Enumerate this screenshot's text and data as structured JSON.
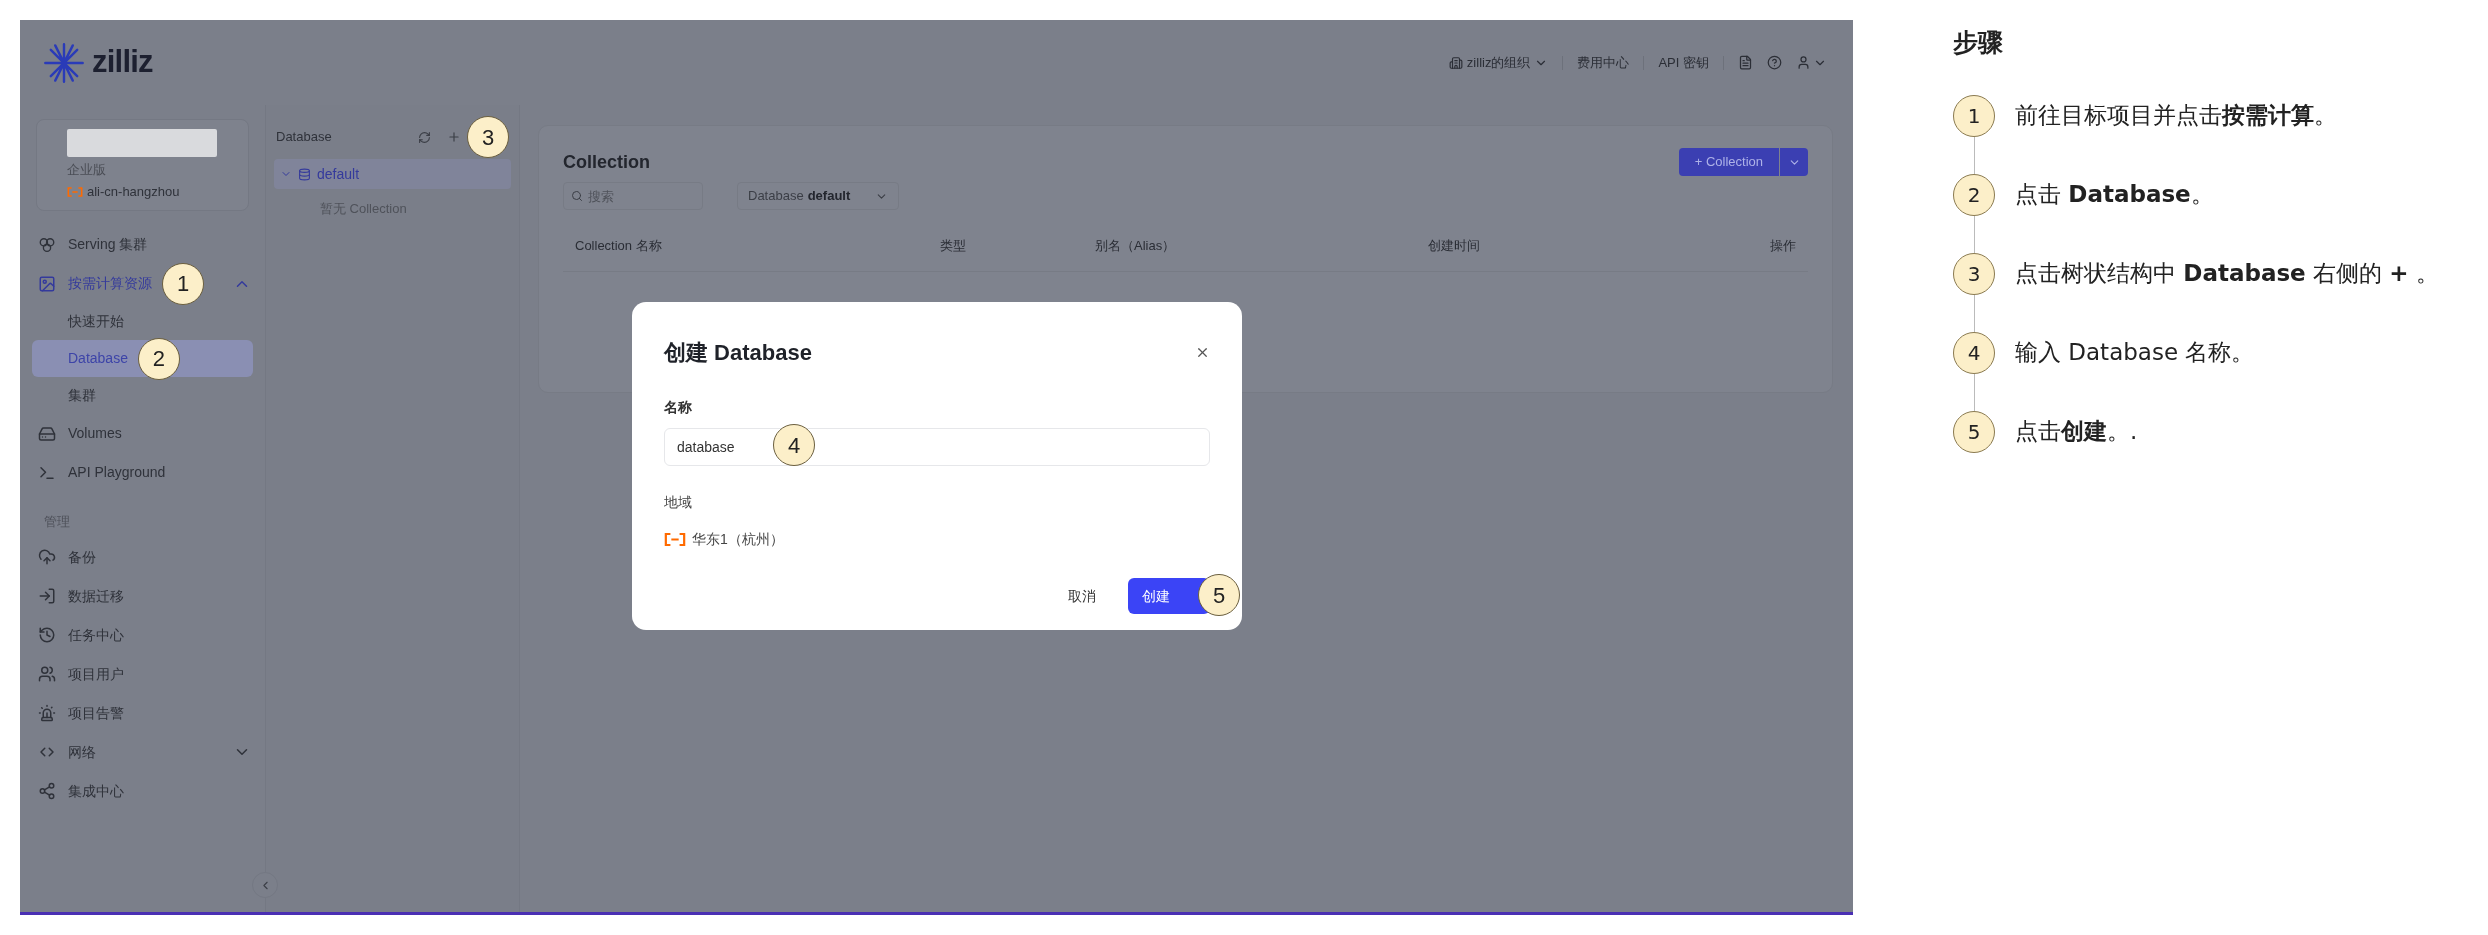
{
  "header": {
    "logo_text": "zilliz",
    "org": "zilliz的组织",
    "links": [
      "费用中心",
      "API 密钥"
    ]
  },
  "project": {
    "edition": "企业版",
    "region": "ali-cn-hangzhou"
  },
  "sidebar": {
    "items": [
      {
        "label": "Serving 集群",
        "selected": false
      },
      {
        "label": "按需计算资源",
        "selected": true,
        "expanded": true,
        "marker": "1",
        "children": [
          {
            "label": "快速开始",
            "selected": false
          },
          {
            "label": "Database",
            "selected": true,
            "marker": "2"
          },
          {
            "label": "集群",
            "selected": false
          }
        ]
      },
      {
        "label": "Volumes",
        "selected": false
      },
      {
        "label": "API Playground",
        "selected": false
      }
    ],
    "section": "管理",
    "manage_items": [
      {
        "label": "备份",
        "selected": false
      },
      {
        "label": "数据迁移",
        "selected": false
      },
      {
        "label": "任务中心",
        "selected": false
      },
      {
        "label": "项目用户",
        "selected": false
      },
      {
        "label": "项目告警",
        "selected": false
      },
      {
        "label": "网络",
        "selected": false,
        "expanded": false
      },
      {
        "label": "集成中心",
        "selected": false
      }
    ]
  },
  "tree": {
    "title": "Database",
    "marker": "3",
    "nodes": [
      {
        "label": "default",
        "expanded": true,
        "selected": true,
        "empty_text": "暂无 Collection"
      }
    ]
  },
  "main": {
    "title": "Collection",
    "search_placeholder": "搜索",
    "database_select": {
      "label": "Database",
      "value": "default"
    },
    "new_button": "+ Collection",
    "columns": [
      "Collection 名称",
      "类型",
      "别名（Alias）",
      "创建时间",
      "操作"
    ]
  },
  "dialog": {
    "title": "创建 Database",
    "name_label": "名称",
    "name_value": "database",
    "name_marker": "4",
    "region_label": "地域",
    "region_value": "华东1（杭州）",
    "cancel": "取消",
    "confirm": "创建",
    "confirm_marker": "5"
  },
  "steps": {
    "title": "步骤",
    "items": [
      {
        "number": "1",
        "text": "前往目标项目并点击**按需计算**。"
      },
      {
        "number": "2",
        "text": "点击 **Database**。"
      },
      {
        "number": "3",
        "text": "点击树状结构中 **Database** 右侧的 **+** 。"
      },
      {
        "number": "4",
        "text": "输入 Database 名称。"
      },
      {
        "number": "5",
        "text": "点击**创建**。."
      }
    ]
  }
}
